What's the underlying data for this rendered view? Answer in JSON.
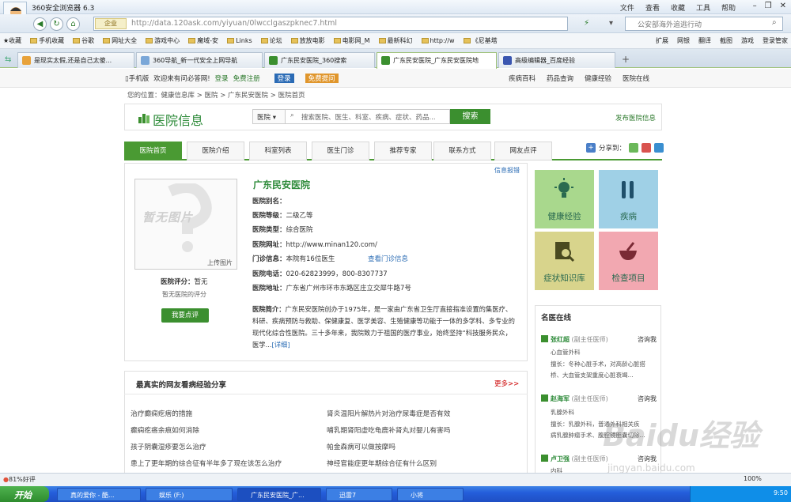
{
  "browser": {
    "title": "360安全浏览器 6.3",
    "menu": [
      "文件",
      "查看",
      "收藏",
      "工具",
      "帮助"
    ],
    "enterprise_badge": "企业",
    "url": "http://data.120ask.com/yiyuan/0lwcclgaszpknec7.html",
    "address_search": "公安部海外追逃行动",
    "bookmarks": [
      "收藏",
      "手机收藏",
      "谷歌",
      "网址大全",
      "游戏中心",
      "魔域-安",
      "Links",
      "论坛",
      "放放电影",
      "电影网_M",
      "最新科幻",
      "http://w",
      "《尼基塔"
    ],
    "toolbar_right": [
      "扩展",
      "网银",
      "翻译",
      "截图",
      "游戏",
      "登录管家"
    ],
    "tabs": [
      {
        "label": "是现实太假,还是自己太傻...",
        "color": "#e8a23a"
      },
      {
        "label": "360导航_新一代安全上网导航",
        "color": "#7aa7d8"
      },
      {
        "label": "广东民安医院_360搜索",
        "color": "#3b8f2f"
      },
      {
        "label": "广东民安医院_广东民安医院地",
        "color": "#3b8f2f"
      },
      {
        "label": "高级编辑器_百度经验",
        "color": "#3a56b0"
      }
    ],
    "status_left": "81%好评",
    "zoom": "100%",
    "clock": "9:50"
  },
  "site": {
    "topbar_left": [
      "手机版",
      "欢迎来有问必答网!",
      "登录",
      "免费注册",
      "登录",
      "免费提问"
    ],
    "topbar_right": [
      "疾病百科",
      "药品查询",
      "健康经验",
      "医院在线"
    ],
    "breadcrumb": "您的位置：健康信息库 > 医院 > 广东民安医院 > 医院首页",
    "title": "医院信息",
    "search_select": "医院",
    "search_placeholder": "搜索医院、医生、科室、疾病、症状、药品...",
    "search_button": "搜索",
    "publish": "发布医院信息",
    "nav": [
      "医院首页",
      "医院介绍",
      "科室列表",
      "医生门诊",
      "推荐专家",
      "联系方式",
      "网友点评"
    ],
    "share": "分享到：",
    "report": "信息报错"
  },
  "hospital": {
    "photo_text": "暂无图片",
    "upload": "上传图片",
    "rating_label": "医院评分：",
    "rating_value": "暂无",
    "no_rating": "暂无医院的评分",
    "review_btn": "我要点评",
    "name": "广东民安医院",
    "alias_label": "医院别名：",
    "alias": "",
    "level_label": "医院等级：",
    "level": "二级乙等",
    "type_label": "医院类型：",
    "type": "综合医院",
    "site_label": "医院网址：",
    "site": "http://www.minan120.com/",
    "opd_label": "门诊信息：",
    "opd": "本院有16位医生",
    "opd_link": "查看门诊信息",
    "phone_label": "医院电话：",
    "phone": "020-62823999，800-8307737",
    "addr_label": "医院地址：",
    "addr": "广东省广州市环市东路区庄立交犀牛路7号",
    "intro_label": "医院简介：",
    "intro": "广东民安医院创办于1975年，是一家由广东省卫生厅直接指准设置的集医疗、科研、疾病预防与救助、保健康复、医学美容、生殖健康等功能于一体的多学科、多专业的现代化综合性医院。三十多年来，我院致力于祖国的医疗事业，始终坚持“科技服务民众，医学...",
    "detail": "[详细]"
  },
  "experience": {
    "title": "最真实的网友看病经验分享",
    "more": "更多>>",
    "left": [
      "治疗癫痫疙瘩的措施",
      "癫痫疙瘩余痕如何消除",
      "孩子阴囊湿疹要怎么治疗",
      "患上了更年期的综合征有半年多了现在该怎么治疗"
    ],
    "right": [
      "肾炎温阳片解热片对治疗尿毒症是否有效",
      "哺乳期肾阳虚吃龟鹿补肾丸对婴儿有害吗",
      "帕金森病可以做按摩吗",
      "神经官能症更年期综合征有什么区别"
    ]
  },
  "tiles": [
    {
      "label": "健康经验",
      "color": "#a9d88d"
    },
    {
      "label": "疾病",
      "color": "#9fd0e6"
    },
    {
      "label": "症状知识库",
      "color": "#d8d48c"
    },
    {
      "label": "检查项目",
      "color": "#f2a8b1"
    }
  ],
  "doctors_title": "名医在线",
  "doctors": [
    {
      "name": "张红超",
      "title": "(副主任医师)",
      "ask": "咨询我",
      "dept": "心血管外科",
      "spec1": "擅长：冬种心脏手术，对高龄心脏搭",
      "spec2": "桥、大血管支架重度心脏衰竭..."
    },
    {
      "name": "赵海军",
      "title": "(副主任医师)",
      "ask": "咨询我",
      "dept": "乳腺外科",
      "spec1": "擅长：乳腺外科，普通外科相关疾",
      "spec2": "病乳腺肿瘤手术、腹腔镜胆囊切除..."
    },
    {
      "name": "卢卫强",
      "title": "(副主任医师)",
      "ask": "咨询我",
      "dept": "内科",
      "spec1": "",
      "spec2": ""
    }
  ],
  "taskbar": {
    "start": "开始",
    "tasks": [
      "真的爱你 - 酷...",
      "娱乐 (F:)",
      "广东民安医院_广...",
      "迅雷7",
      "小将"
    ]
  },
  "watermark": "Baidu经验",
  "watermark_url": "jingyan.baidu.com"
}
